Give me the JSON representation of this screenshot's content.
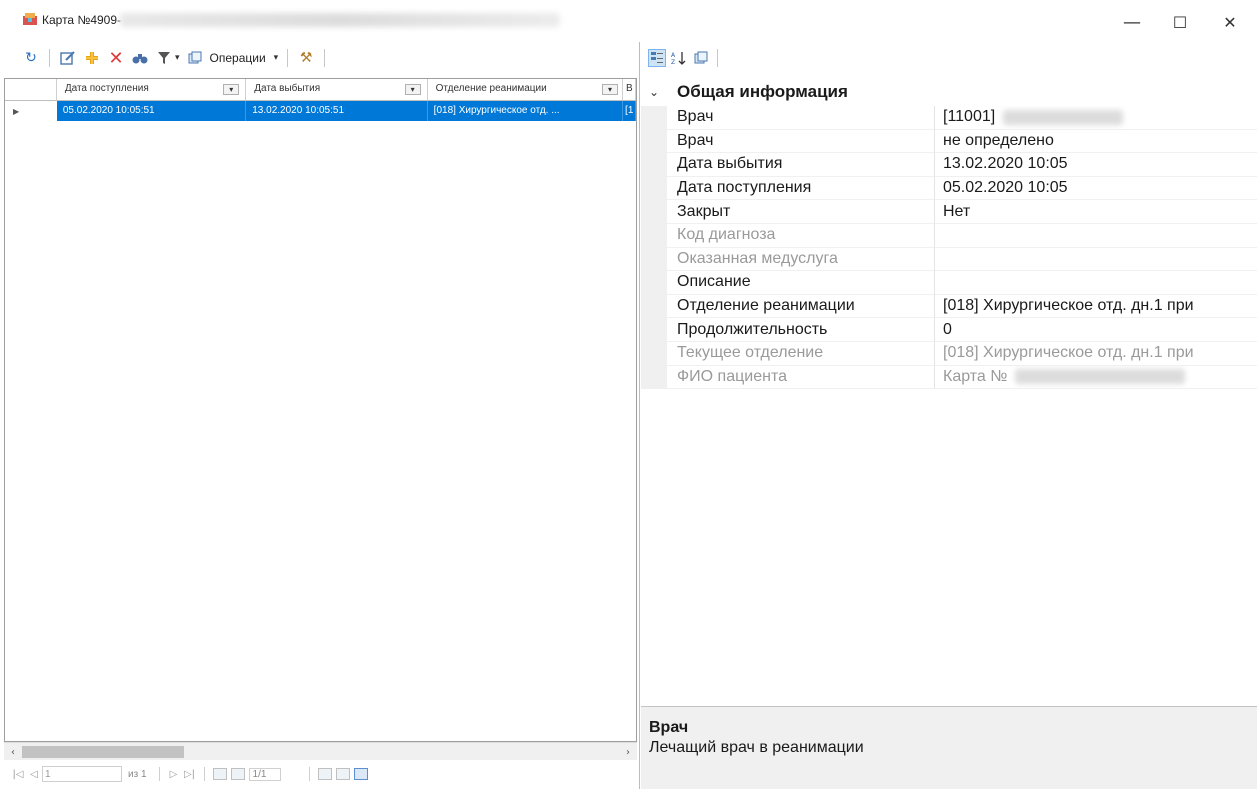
{
  "window": {
    "title": "Карта №4909-",
    "minimize": "—",
    "maximize": "☐",
    "close": "✕"
  },
  "toolbar": {
    "operations_label": "Операции"
  },
  "grid": {
    "columns": [
      "Дата поступления",
      "Дата выбытия",
      "Отделение реанимации",
      "В"
    ],
    "rows": [
      {
        "indicator": "▶",
        "cells": [
          "05.02.2020 10:05:51",
          "13.02.2020 10:05:51",
          "[018] Хирургическое отд. ...",
          "[1"
        ]
      }
    ]
  },
  "navigator": {
    "first": "|◁",
    "prev": "◁",
    "page_value": "1",
    "of_label": "из 1",
    "next": "▷",
    "last": "▷|",
    "record_count": "1/1"
  },
  "property_grid": {
    "category": "Общая информация",
    "rows": [
      {
        "name": "Врач",
        "value": "[11001]",
        "readonly": false
      },
      {
        "name": "Врач",
        "value": "не определено",
        "readonly": false
      },
      {
        "name": "Дата выбытия",
        "value": "13.02.2020 10:05",
        "readonly": false
      },
      {
        "name": "Дата поступления",
        "value": "05.02.2020 10:05",
        "readonly": false
      },
      {
        "name": "Закрыт",
        "value": "Нет",
        "readonly": false
      },
      {
        "name": "Код диагноза",
        "value": "",
        "readonly": true
      },
      {
        "name": "Оказанная медуслуга",
        "value": "",
        "readonly": true
      },
      {
        "name": "Описание",
        "value": "",
        "readonly": false
      },
      {
        "name": "Отделение реанимации",
        "value": "[018] Хирургическое отд. дн.1 при",
        "readonly": false
      },
      {
        "name": "Продолжительность",
        "value": "0",
        "readonly": false
      },
      {
        "name": "Текущее отделение",
        "value": "[018] Хирургическое отд. дн.1 при",
        "readonly": true
      },
      {
        "name": "ФИО пациента",
        "value": "Карта №",
        "readonly": true
      }
    ]
  },
  "description": {
    "title": "Врач",
    "text": "Лечащий врач в реанимации"
  },
  "colors": {
    "selection": "#0078d7",
    "readonly_text": "#9a9a9a",
    "pane_bg": "#f0f0f0"
  }
}
